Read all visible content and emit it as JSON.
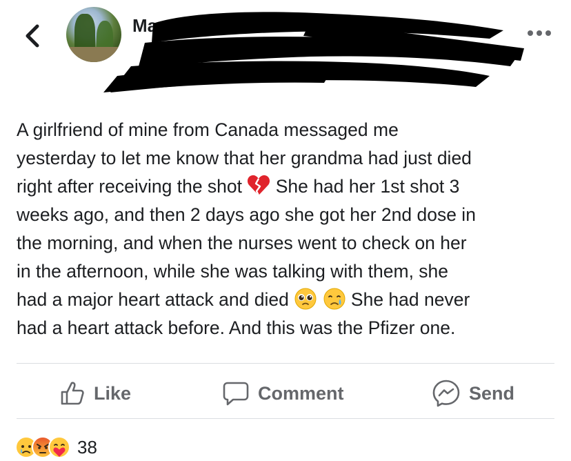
{
  "header": {
    "author_name_visible": "Ma"
  },
  "post": {
    "line1": "A girlfriend of mine from Canada messaged me",
    "line2": "yesterday to let me know that her grandma had just died",
    "line3a": "right after receiving the shot ",
    "line3b": " She had her 1st shot 3",
    "line4": "weeks ago, and then 2 days ago she got her 2nd dose in",
    "line5": "the morning, and when the nurses went to check on her",
    "line6": "in the afternoon, while she was talking with them, she",
    "line7a": "had a major heart attack and died ",
    "line7b": " She had never",
    "line8": "had a heart attack before. And this was the Pfizer one."
  },
  "actions": {
    "like_label": "Like",
    "comment_label": "Comment",
    "send_label": "Send"
  },
  "reactions": {
    "icons": [
      "sad-reaction",
      "angry-reaction",
      "care-reaction"
    ],
    "count": "38"
  },
  "colors": {
    "text": "#1c1e21",
    "muted": "#65676b",
    "divider": "#dadde1",
    "redaction": "#000000"
  }
}
